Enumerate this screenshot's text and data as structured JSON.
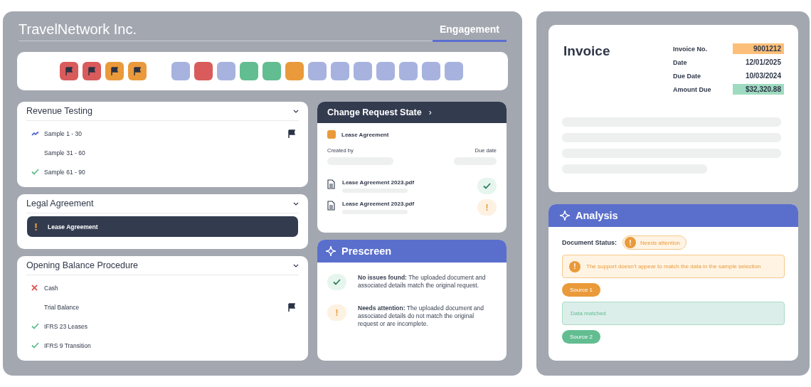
{
  "company": "TravelNetwork Inc.",
  "tab": {
    "label": "Engagement",
    "selected": true
  },
  "flag_tiles": [
    {
      "color": "#d95b5b"
    },
    {
      "color": "#d95b5b"
    },
    {
      "color": "#ea9a3a"
    },
    {
      "color": "#ea9a3a"
    }
  ],
  "tiles": [
    {
      "color": "#a7b3de"
    },
    {
      "color": "#d95b5b"
    },
    {
      "color": "#a7b3de"
    },
    {
      "color": "#62bd91"
    },
    {
      "color": "#62bd91"
    },
    {
      "color": "#ea9a3a"
    },
    {
      "color": "#a7b3de"
    },
    {
      "color": "#a7b3de"
    },
    {
      "color": "#a7b3de"
    },
    {
      "color": "#a7b3de"
    },
    {
      "color": "#a7b3de"
    },
    {
      "color": "#a7b3de"
    },
    {
      "color": "#a7b3de"
    }
  ],
  "sections": [
    {
      "title": "Revenue Testing",
      "expanded": true,
      "items": [
        {
          "label": "Sample 1 - 30",
          "kind": "progress",
          "flagged": true,
          "selected": false
        },
        {
          "label": "Sample 31 - 60",
          "kind": "plain",
          "flagged": false,
          "selected": false
        },
        {
          "label": "Sample 61 - 90",
          "kind": "done",
          "flagged": false,
          "selected": false
        }
      ]
    },
    {
      "title": "Legal Agreement",
      "expanded": true,
      "items": [
        {
          "label": "Lease Agreement",
          "kind": "warning",
          "flagged": false,
          "selected": true
        }
      ]
    },
    {
      "title": "Opening Balance Procedure",
      "expanded": true,
      "items": [
        {
          "label": "Cash",
          "kind": "failed",
          "flagged": false,
          "selected": false
        },
        {
          "label": "Trial Balance",
          "kind": "plain",
          "flagged": true,
          "selected": false
        },
        {
          "label": "IFRS 23 Leases",
          "kind": "done",
          "flagged": false,
          "selected": false
        },
        {
          "label": "IFRS 9 Transition",
          "kind": "done",
          "flagged": false,
          "selected": false
        }
      ]
    }
  ],
  "change_request": {
    "title": "Change Request State",
    "chevron": "›",
    "tag": {
      "label": "Lease Agreement",
      "color": "#ea9a3a"
    },
    "created_by": "Created by",
    "due_date": "Due date",
    "files": [
      {
        "name": "Lease Agreement 2023.pdf",
        "kind": "ok"
      },
      {
        "name": "Lease Agreement 2023.pdf",
        "kind": "warning",
        "mark": "!"
      }
    ]
  },
  "prescreen": {
    "title": "Prescreen",
    "items": [
      {
        "kind": "ok",
        "text": "**No issues found:** The uploaded document and associated details match the original request."
      },
      {
        "kind": "warning",
        "mark": "!",
        "text": "**Needs attention:** The uploaded document and associated details do not match the original request or are incomplete."
      }
    ]
  },
  "invoice": {
    "title": "Invoice",
    "fields": [
      {
        "label": "Invoice No.",
        "value": "9001212",
        "color": "#fbbf79"
      },
      {
        "label": "Date",
        "value": "12/01/2025"
      },
      {
        "label": "Due Date",
        "value": "10/03/2024"
      },
      {
        "label": "Amount Due",
        "value": "$32,320.88",
        "color": "#9fdbc0"
      }
    ]
  },
  "analysis": {
    "title": "Analysis",
    "status_label": "Document Status:",
    "status_badge": {
      "mark": "!",
      "text": "Needs attention"
    },
    "blocks": [
      {
        "kind": "alert",
        "mark": "!",
        "text": "The support doesn’t appear to match the data in the sample selection"
      },
      {
        "kind": "chip",
        "text": "Source 1",
        "color": "#ea9a3a"
      },
      {
        "kind": "match",
        "text": "Data matched"
      },
      {
        "kind": "chip",
        "text": "Source 2",
        "color": "#62bd91"
      }
    ]
  }
}
